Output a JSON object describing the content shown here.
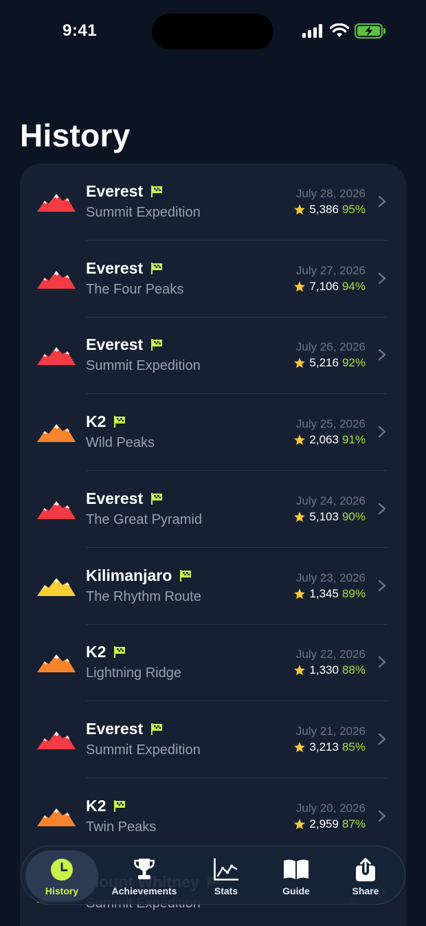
{
  "status_bar": {
    "time": "9:41"
  },
  "page": {
    "title": "History"
  },
  "history": [
    {
      "peak": "Everest",
      "route": "Summit Expedition",
      "date": "July 28, 2026",
      "score": "5,386",
      "percent": "95%",
      "color": "#f23b45"
    },
    {
      "peak": "Everest",
      "route": "The Four Peaks",
      "date": "July 27, 2026",
      "score": "7,106",
      "percent": "94%",
      "color": "#f23b45"
    },
    {
      "peak": "Everest",
      "route": "Summit Expedition",
      "date": "July 26, 2026",
      "score": "5,216",
      "percent": "92%",
      "color": "#f23b45"
    },
    {
      "peak": "K2",
      "route": "Wild Peaks",
      "date": "July 25, 2026",
      "score": "2,063",
      "percent": "91%",
      "color": "#f7832b"
    },
    {
      "peak": "Everest",
      "route": "The Great Pyramid",
      "date": "July 24, 2026",
      "score": "5,103",
      "percent": "90%",
      "color": "#f23b45"
    },
    {
      "peak": "Kilimanjaro",
      "route": "The Rhythm Route",
      "date": "July 23, 2026",
      "score": "1,345",
      "percent": "89%",
      "color": "#f7cf35"
    },
    {
      "peak": "K2",
      "route": "Lightning Ridge",
      "date": "July 22, 2026",
      "score": "1,330",
      "percent": "88%",
      "color": "#f7832b"
    },
    {
      "peak": "Everest",
      "route": "Summit Expedition",
      "date": "July 21, 2026",
      "score": "3,213",
      "percent": "85%",
      "color": "#f23b45"
    },
    {
      "peak": "K2",
      "route": "Twin Peaks",
      "date": "July 20, 2026",
      "score": "2,959",
      "percent": "87%",
      "color": "#f7832b"
    },
    {
      "peak": "Mount Whitney",
      "route": "Summit Expedition",
      "date": "",
      "score": "",
      "percent": "",
      "color": "#a5e03a"
    }
  ],
  "tab_bar": {
    "tabs": [
      {
        "label": "History",
        "icon": "clock-icon",
        "active": true
      },
      {
        "label": "Achievements",
        "icon": "trophy-icon",
        "active": false
      },
      {
        "label": "Stats",
        "icon": "chart-icon",
        "active": false
      },
      {
        "label": "Guide",
        "icon": "book-icon",
        "active": false
      },
      {
        "label": "Share",
        "icon": "share-icon",
        "active": false
      }
    ]
  },
  "colors": {
    "background": "#0c1322",
    "card": "#162032",
    "accent": "#c9f24a",
    "percent": "#a5e03a",
    "star": "#f7c737"
  }
}
